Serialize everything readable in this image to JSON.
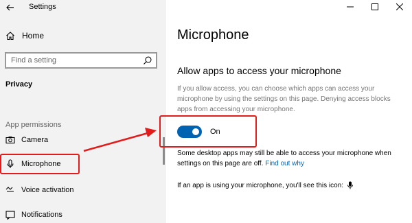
{
  "window": {
    "title": "Settings",
    "controls": [
      "minimize-icon",
      "maximize-icon",
      "close-icon"
    ]
  },
  "sidebar": {
    "home_label": "Home",
    "search_placeholder": "Find a setting",
    "section_title": "Privacy",
    "group_label": "App permissions",
    "items": [
      {
        "label": "Camera",
        "icon": "camera-icon"
      },
      {
        "label": "Microphone",
        "icon": "microphone-icon",
        "selected": true
      },
      {
        "label": "Voice activation",
        "icon": "voice-activation-icon"
      },
      {
        "label": "Notifications",
        "icon": "notifications-icon"
      }
    ]
  },
  "main": {
    "title": "Microphone",
    "subheading": "Allow apps to access your microphone",
    "description": "If you allow access, you can choose which apps can access your microphone by using the settings on this page. Denying access blocks apps from accessing your microphone.",
    "toggle_label": "On",
    "toggle_state": "on",
    "note_text": "Some desktop apps may still be able to access your microphone when settings on this page are off.",
    "note_link": "Find out why",
    "icon_note": "If an app is using your microphone, you'll see this icon:"
  },
  "colors": {
    "accent": "#0063b1",
    "annotation": "#e31b1b",
    "sidebar_bg": "#f2f2f2"
  }
}
